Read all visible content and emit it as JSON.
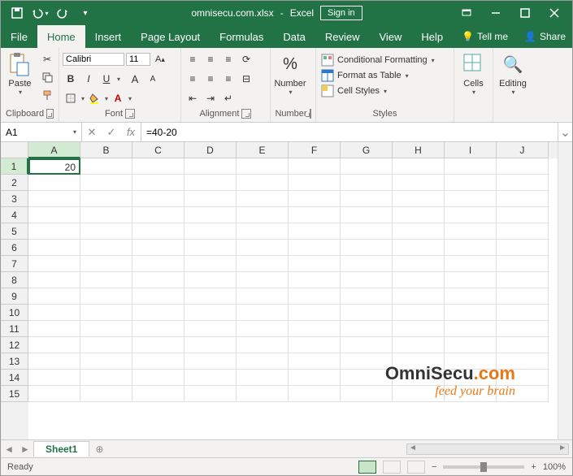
{
  "titlebar": {
    "filename": "omnisecu.com.xlsx",
    "app": "Excel",
    "signin": "Sign in"
  },
  "menubar": {
    "tabs": [
      "File",
      "Home",
      "Insert",
      "Page Layout",
      "Formulas",
      "Data",
      "Review",
      "View",
      "Help"
    ],
    "tellme": "Tell me",
    "share": "Share"
  },
  "ribbon": {
    "clipboard": {
      "label": "Clipboard",
      "paste": "Paste"
    },
    "font": {
      "label": "Font",
      "name": "Calibri",
      "size": "11",
      "bold": "B",
      "italic": "I",
      "underline": "U"
    },
    "alignment": {
      "label": "Alignment"
    },
    "number": {
      "label": "Number",
      "btn": "Number"
    },
    "styles": {
      "label": "Styles",
      "cf": "Conditional Formatting",
      "fat": "Format as Table",
      "cs": "Cell Styles"
    },
    "cells": {
      "label": "Cells",
      "btn": "Cells"
    },
    "editing": {
      "label": "Editing",
      "btn": "Editing"
    }
  },
  "formulabar": {
    "namebox": "A1",
    "formula": "=40-20"
  },
  "grid": {
    "cols": [
      "A",
      "B",
      "C",
      "D",
      "E",
      "F",
      "G",
      "H",
      "I",
      "J"
    ],
    "rows": [
      "1",
      "2",
      "3",
      "4",
      "5",
      "6",
      "7",
      "8",
      "9",
      "10",
      "11",
      "12",
      "13",
      "14",
      "15"
    ],
    "a1": "20"
  },
  "sheettabs": {
    "sheet1": "Sheet1"
  },
  "statusbar": {
    "ready": "Ready",
    "zoom": "100%"
  },
  "watermark": {
    "line1a": "Omni",
    "line1b": "Secu",
    "line1c": ".com",
    "line2": "feed your brain"
  }
}
